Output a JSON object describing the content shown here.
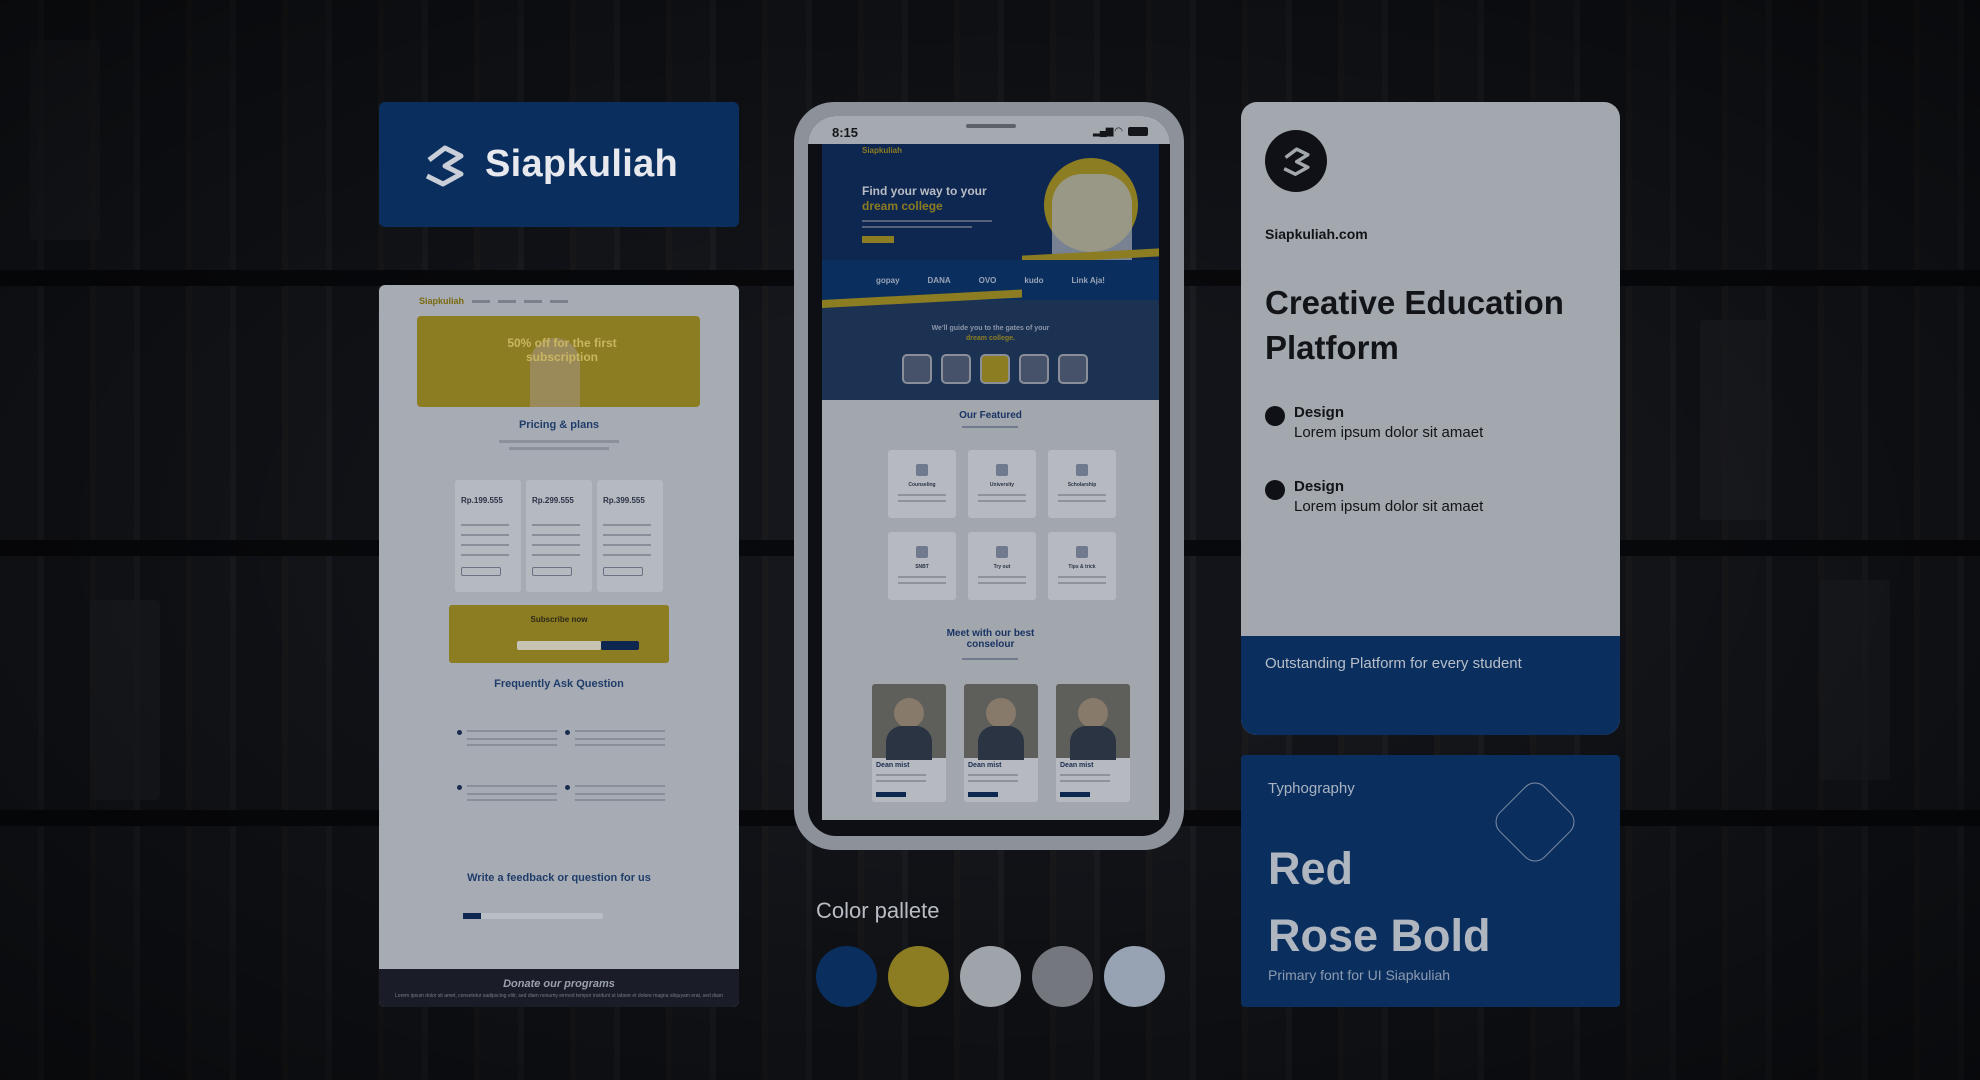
{
  "brand": {
    "name": "Siapkuliah",
    "domain": "Siapkuliah.com"
  },
  "pricing_mock": {
    "nav_brand": "Siapkuliah",
    "hero_text": "50% off for the first subscription",
    "pricing_title": "Pricing & plans",
    "plans": [
      {
        "price": "Rp.199.555"
      },
      {
        "price": "Rp.299.555"
      },
      {
        "price": "Rp.399.555"
      }
    ],
    "subscribe_title": "Subscribe now",
    "faq_title": "Frequently Ask Question",
    "feedback_title": "Write a feedback or question for us",
    "footer_title": "Donate our programs",
    "footer_text": "Lorem ipsum dolor sit amet, consetetur sadipscing elitr, sed diam nonumy eirmod tempor invidunt ut labore et dolore magna aliquyam erat, sed diam"
  },
  "phone": {
    "time": "8:15",
    "nav_brand": "Siapkuliah",
    "hero_line1": "Find your way to your",
    "hero_line2": "dream college",
    "payments": [
      "gopay",
      "DANA",
      "OVO",
      "kudo",
      "Link Aja!"
    ],
    "guide_line1": "We'll guide you to the gates of your",
    "guide_line2": "dream college.",
    "featured_title": "Our Featured",
    "features": [
      "Counseling",
      "University",
      "Scholarship",
      "SNBT",
      "Try out",
      "Tips & trick"
    ],
    "counselor_title": "Meet with our best conselour",
    "counselors": [
      "Dean mist",
      "Dean mist",
      "Dean mist"
    ]
  },
  "palette": {
    "label": "Color pallete",
    "colors": [
      "#0a2f5e",
      "#8c7c22",
      "#9fa3aa",
      "#74777e",
      "#97a3b3"
    ]
  },
  "info_card": {
    "title": "Creative Education Platform",
    "features": [
      {
        "heading": "Design",
        "text": "Lorem ipsum dolor sit amaet"
      },
      {
        "heading": "Design",
        "text": "Lorem ipsum dolor sit amaet"
      }
    ],
    "footer": "Outstanding Platform for every student"
  },
  "typography": {
    "label": "Typhography",
    "font_line1": "Red",
    "font_line2": "Rose Bold",
    "caption": "Primary font for UI Siapkuliah"
  }
}
